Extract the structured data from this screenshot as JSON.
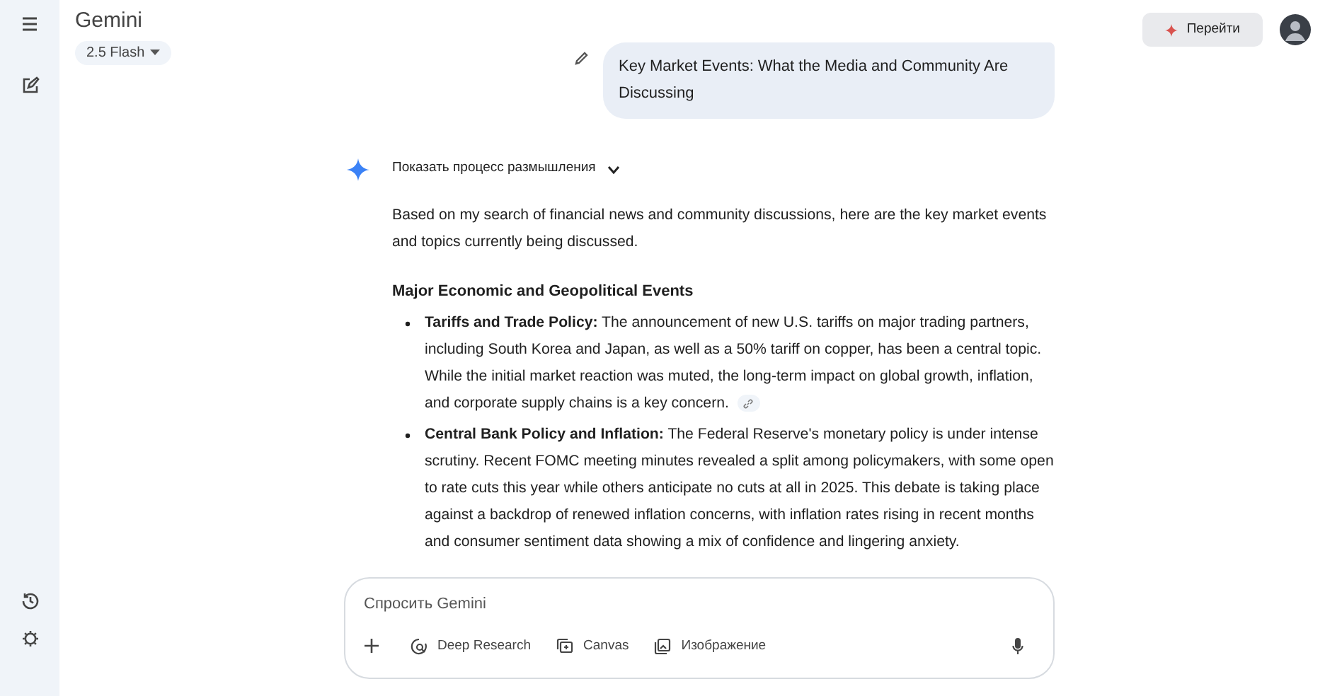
{
  "app": {
    "title": "Gemini",
    "model": "2.5 Flash",
    "upgrade_button": "Перейти"
  },
  "user_message": "Key Market Events: What the Media and Community Are Discussing",
  "thinking": {
    "label": "Показать процесс размышления",
    "expanded": false
  },
  "response": {
    "intro": "Based on my search of financial news and community discussions, here are the key market events and topics currently being discussed.",
    "heading": "Major Economic and Geopolitical Events",
    "bullets": [
      {
        "text": "**Tariffs and Trade Policy:** The announcement of new U.S. tariffs on major trading partners, including South Korea and Japan, as well as a 50% tariff on copper, has been a central topic. While the initial market reaction was muted, the long-term impact on global growth, inflation, and corporate supply chains is a key concern.",
        "citation": true
      },
      {
        "text": "**Central Bank Policy and Inflation:** The Federal Reserve's monetary policy is under intense scrutiny. Recent FOMC meeting minutes revealed a split among policymakers, with some open to rate cuts this year while others anticipate no cuts at all in 2025. This debate is taking place against a backdrop of renewed inflation concerns, with inflation rates rising in recent months and consumer sentiment data showing a mix of confidence and lingering anxiety.",
        "citation": false
      }
    ]
  },
  "input": {
    "placeholder": "Спросить Gemini",
    "tools": [
      "Deep Research",
      "Canvas",
      "Изображение"
    ]
  }
}
